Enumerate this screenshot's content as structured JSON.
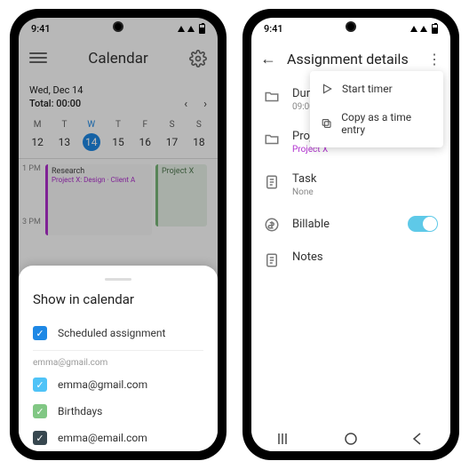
{
  "status_time": "9:41",
  "phone1": {
    "title": "Calendar",
    "date_line": "Wed, Dec 14",
    "total_line": "Total: 00:00",
    "days": [
      {
        "d": "M",
        "n": "12"
      },
      {
        "d": "T",
        "n": "13"
      },
      {
        "d": "W",
        "n": "14"
      },
      {
        "d": "T",
        "n": "15"
      },
      {
        "d": "F",
        "n": "16"
      },
      {
        "d": "S",
        "n": "17"
      },
      {
        "d": "S",
        "n": "18"
      }
    ],
    "hour1": "1 PM",
    "hour3": "3 PM",
    "event1_title": "Research",
    "event1_sub": "Project X: Design · Client A",
    "event2_title": "Project X",
    "sheet_title": "Show in calendar",
    "row_scheduled": "Scheduled assignment",
    "row_account": "emma@gmail.com",
    "row_cal1": "emma@gmail.com",
    "row_cal2": "Birthdays",
    "row_cal3": "emma@email.com"
  },
  "phone2": {
    "title": "Assignment details",
    "duration_label": "Duration",
    "duration_sub": "09:00 - 12:00",
    "project_label": "Project",
    "project_sub": "Project X",
    "task_label": "Task",
    "task_sub": "None",
    "billable_label": "Billable",
    "notes_label": "Notes",
    "menu_start": "Start timer",
    "menu_copy": "Copy as a time entry"
  }
}
